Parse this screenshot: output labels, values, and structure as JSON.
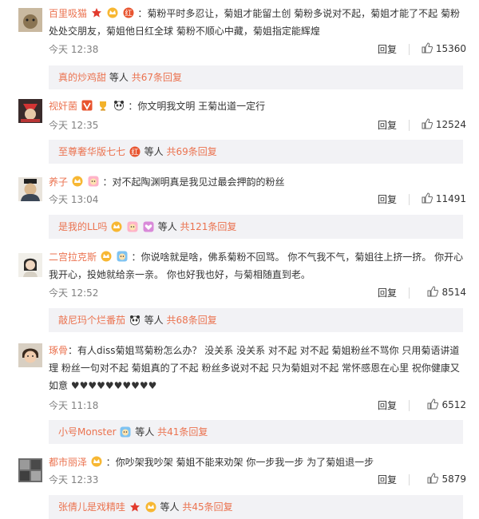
{
  "colors": {
    "link": "#eb7350",
    "text": "#333333",
    "meta": "#808080",
    "subBg": "#f2f2f5"
  },
  "labels": {
    "reply": "回复",
    "others_prefix": "等人"
  },
  "comments": [
    {
      "author": "百里吸猫",
      "text": "菊粉平时多忍让，菊姐才能留土创 菊粉多说对不起，菊姐才能了不起 菊粉处处交朋友，菊姐他日红全球 菊粉不顺心中藏，菊姐指定能辉煌",
      "time": "今天 12:38",
      "likes": "15360",
      "sub": {
        "name": "真的炒鸡甜",
        "others": "等人",
        "more": "共67条回复"
      }
    },
    {
      "author": "视奸菌",
      "text": "你文明我文明 王菊出道一定行",
      "time": "今天 12:35",
      "likes": "12524",
      "sub": {
        "name": "至尊奢华版七七",
        "others": "等人",
        "more": "共69条回复"
      }
    },
    {
      "author": "养子",
      "text": "对不起陶渊明真是我见过最会押韵的粉丝",
      "time": "今天 13:04",
      "likes": "11491",
      "sub": {
        "name": "是我的LL吗",
        "others": "等人",
        "more": "共121条回复"
      }
    },
    {
      "author": "二宫拉克斯",
      "text_lines": [
        "你说啥就是啥，佛系菊粉不回骂。 你不气我不气，菊姐往上挤一挤。 你开心",
        "我开心，投她就给亲一亲。 你也好我也好，与菊相随直到老。"
      ],
      "time": "今天 12:52",
      "likes": "8514",
      "sub": {
        "name": "敲尼玛个烂番茄",
        "others": "等人",
        "more": "共68条回复"
      }
    },
    {
      "author": "琢骨",
      "text_lines": [
        "有人diss菊姐骂菊粉怎么办？ 没关系 没关系 对不起 对不起 菊姐粉丝不骂你 只用菊语讲道",
        "理 粉丝一句对不起 菊姐真的了不起 粉丝多说对不起 只为菊姐对不起 常怀感恩在心里 祝你健康又",
        "如意 ♥♥♥♥♥♥♥♥♥♥"
      ],
      "time": "今天 11:18",
      "likes": "6512",
      "sub": {
        "name": "小号Monster",
        "others": "等人",
        "more": "共41条回复"
      }
    },
    {
      "author": "都市丽泽",
      "text": "你吵架我吵架 菊姐不能来劝架 你一步我一步 为了菊姐退一步",
      "time": "今天 12:33",
      "likes": "5879",
      "sub": {
        "name": "张倩儿是戏精哇",
        "others": "等人",
        "more": "共45条回复"
      }
    }
  ]
}
